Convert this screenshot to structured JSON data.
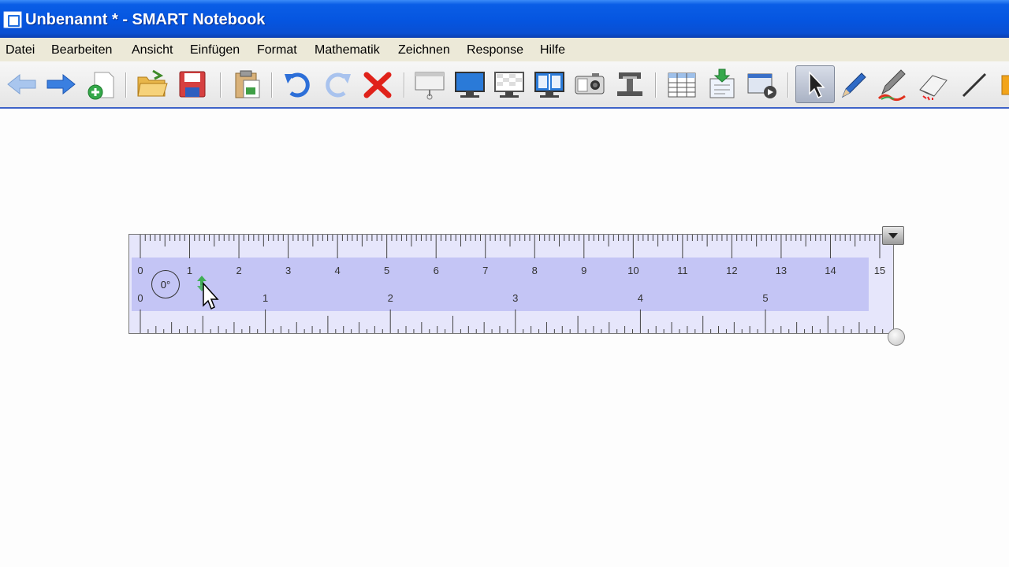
{
  "window": {
    "title": "Unbenannt * - SMART Notebook"
  },
  "menu": {
    "items": [
      "Datei",
      "Bearbeiten",
      "Ansicht",
      "Einfügen",
      "Format",
      "Mathematik",
      "Zeichnen",
      "Response",
      "Hilfe"
    ]
  },
  "toolbar": {
    "buttons": [
      "back-arrow-icon",
      "forward-arrow-icon",
      "add-page-icon",
      "open-folder-icon",
      "save-disk-icon",
      "paste-icon",
      "undo-icon",
      "redo-icon",
      "delete-x-icon",
      "screen-shade-icon",
      "full-screen-icon",
      "transparent-background-icon",
      "dual-page-icon",
      "capture-camera-icon",
      "document-camera-icon",
      "table-icon",
      "response-import-icon",
      "video-recorder-icon",
      "select-arrow-icon",
      "pen-icon",
      "creative-pen-icon",
      "eraser-icon",
      "line-icon"
    ],
    "active": "select-arrow-icon"
  },
  "ruler": {
    "angle": "0°",
    "cm_labels": [
      "0",
      "1",
      "2",
      "3",
      "4",
      "5",
      "6",
      "7",
      "8",
      "9",
      "10",
      "11",
      "12",
      "13",
      "14",
      "15"
    ],
    "inch_labels": [
      "0",
      "1",
      "2",
      "3",
      "4",
      "5"
    ],
    "colors": {
      "body": "#c4c5f5",
      "edge": "#e6e6fb",
      "ticks": "#444444",
      "labels": "#333333"
    }
  }
}
